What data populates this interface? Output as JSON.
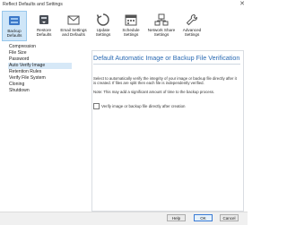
{
  "window": {
    "title": "Reflect Defaults and Settings",
    "close_glyph": "✕"
  },
  "toolbar": {
    "items": [
      {
        "label": "Backup\nDefaults",
        "icon": "backup-defaults-icon",
        "active": true
      },
      {
        "label": "Restore\nDefaults",
        "icon": "restore-defaults-icon",
        "active": false
      },
      {
        "label": "Email Settings\nand Defaults",
        "icon": "email-settings-icon",
        "active": false
      },
      {
        "label": "Update\nSettings",
        "icon": "update-settings-icon",
        "active": false
      },
      {
        "label": "Schedule\nSettings",
        "icon": "schedule-settings-icon",
        "active": false
      },
      {
        "label": "Network Share\nSettings",
        "icon": "network-share-icon",
        "active": false
      },
      {
        "label": "Advanced\nSettings",
        "icon": "advanced-settings-icon",
        "active": false
      }
    ]
  },
  "sidebar": {
    "items": [
      {
        "label": "Compression"
      },
      {
        "label": "File Size"
      },
      {
        "label": "Password"
      },
      {
        "label": "Auto Verify Image",
        "selected": true
      },
      {
        "label": "Retention Rules"
      },
      {
        "label": "Verify File System"
      },
      {
        "label": "Cloning"
      },
      {
        "label": "Shutdown"
      }
    ]
  },
  "main": {
    "heading": "Default Automatic Image or Backup File Verification",
    "description": "Select to automatically verify the integrity of your image or backup file directly after it is created. If files are split then each file is independently verified.",
    "note": "Note: This may add a significant amount of time to the backup process.",
    "checkbox": {
      "label": "Verify image or backup file directly after creation",
      "checked": false
    }
  },
  "footer": {
    "help": "Help",
    "ok": "OK",
    "cancel": "Cancel"
  },
  "colors": {
    "accent": "#2a6ab3",
    "selection": "#d6e8f7",
    "active_toolbar": "#cfe6f8"
  }
}
